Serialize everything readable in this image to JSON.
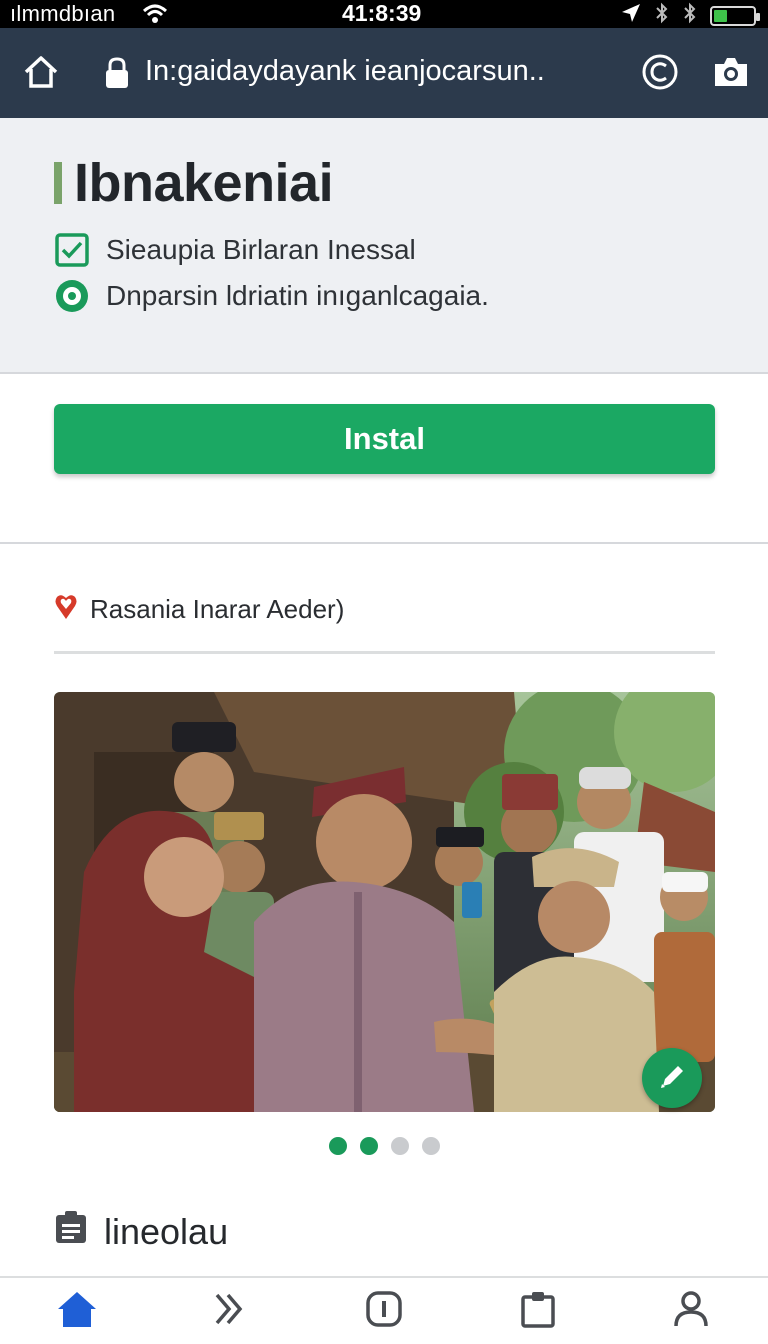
{
  "status_bar": {
    "carrier": "ılmmdbıan",
    "time": "41:8:39",
    "battery_level": 0.35,
    "battery_color": "#3ec24a"
  },
  "browser": {
    "url": "In:gaidaydayank ieanjocarsun..",
    "icons": [
      "home-icon",
      "lock-icon",
      "copyright-icon",
      "camera-icon"
    ]
  },
  "app": {
    "title": "Ibnakeniai",
    "features": [
      {
        "icon": "checkbox-icon",
        "label": "Sieaupia Birlaran Inessal"
      },
      {
        "icon": "radio-icon",
        "label": "Dnparsin ldriatin  inıganlcagaia."
      }
    ],
    "install_label": "Instal",
    "accent_color": "#1ba863"
  },
  "gallery": {
    "heading": "Rasania Inarar Aeder)",
    "heading_icon": "heart-pin-icon",
    "photo_alt": "villagers in traditional clothing looking at phones",
    "page_count": 4,
    "active_pages": [
      0,
      1
    ]
  },
  "description": {
    "heading": "lineolau",
    "icon": "clipboard-icon"
  },
  "bottom_nav": {
    "items": [
      "home",
      "forward",
      "info",
      "clipboard",
      "profile"
    ],
    "active": "home",
    "active_color": "#1f5fd6"
  }
}
